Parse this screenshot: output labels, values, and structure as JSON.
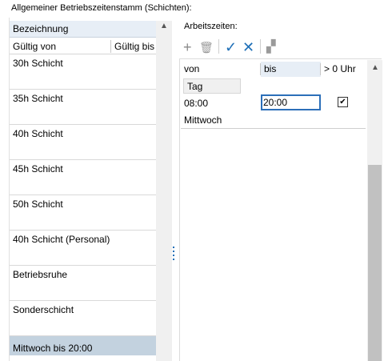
{
  "main_title": "Allgemeiner Betriebszeitenstamm (Schichten):",
  "left": {
    "header_bezeichnung": "Bezeichnung",
    "header_gueltig_von": "Gültig von",
    "header_gueltig_bis": "Gültig bis",
    "scroll_up_glyph": "▲",
    "items": [
      {
        "label": "30h Schicht",
        "selected": false
      },
      {
        "label": "35h Schicht",
        "selected": false
      },
      {
        "label": "40h Schicht",
        "selected": false
      },
      {
        "label": "45h Schicht",
        "selected": false
      },
      {
        "label": "50h Schicht",
        "selected": false
      },
      {
        "label": "40h Schicht (Personal)",
        "selected": false
      },
      {
        "label": "Betriebsruhe",
        "selected": false
      },
      {
        "label": "Sonderschicht",
        "selected": false
      },
      {
        "label": "Mittwoch bis 20:00",
        "selected": true
      }
    ]
  },
  "right": {
    "title": "Arbeitszeiten:",
    "toolbar": {
      "add_glyph": "+",
      "delete_glyph": "🗑",
      "confirm_glyph": "✓",
      "cancel_glyph": "✕",
      "copy_glyph": "▞"
    },
    "columns": {
      "von": "von",
      "bis": "bis",
      "over_midnight": "> 0 Uhr"
    },
    "group_tag": "Tag",
    "entry": {
      "von": "08:00",
      "bis": "20:00",
      "over_midnight_checked": true,
      "checkmark": "✔",
      "day": "Mittwoch"
    },
    "scroll_up_glyph": "▲"
  },
  "colors": {
    "accent": "#2c6fb9",
    "header_bg": "#e7eef6",
    "selected_row": "#c3d2df",
    "toolbar_icon": "#1e6fb7"
  }
}
